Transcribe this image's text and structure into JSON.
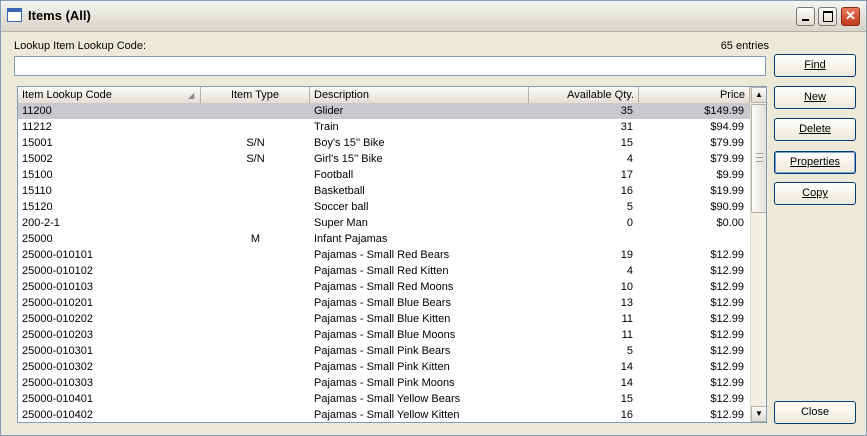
{
  "window": {
    "title": "Items (All)"
  },
  "lookup": {
    "label": "Lookup Item Lookup Code:",
    "value": "",
    "entries": "65 entries"
  },
  "columns": [
    "Item Lookup Code",
    "Item Type",
    "Description",
    "Available Qty.",
    "Price"
  ],
  "rows": [
    {
      "code": "11200",
      "type": "",
      "desc": "Glider",
      "qty": "35",
      "price": "$149.99",
      "selected": true
    },
    {
      "code": "11212",
      "type": "",
      "desc": "Train",
      "qty": "31",
      "price": "$94.99"
    },
    {
      "code": "15001",
      "type": "S/N",
      "desc": "Boy's 15'' Bike",
      "qty": "15",
      "price": "$79.99"
    },
    {
      "code": "15002",
      "type": "S/N",
      "desc": "Girl's 15'' Bike",
      "qty": "4",
      "price": "$79.99"
    },
    {
      "code": "15100",
      "type": "",
      "desc": "Football",
      "qty": "17",
      "price": "$9.99"
    },
    {
      "code": "15110",
      "type": "",
      "desc": "Basketball",
      "qty": "16",
      "price": "$19.99"
    },
    {
      "code": "15120",
      "type": "",
      "desc": "Soccer ball",
      "qty": "5",
      "price": "$90.99"
    },
    {
      "code": "200-2-1",
      "type": "",
      "desc": "Super Man",
      "qty": "0",
      "price": "$0.00"
    },
    {
      "code": "25000",
      "type": "M",
      "desc": "Infant Pajamas",
      "qty": "",
      "price": ""
    },
    {
      "code": "25000-010101",
      "type": "",
      "desc": "Pajamas - Small Red Bears",
      "qty": "19",
      "price": "$12.99"
    },
    {
      "code": "25000-010102",
      "type": "",
      "desc": "Pajamas - Small Red Kitten",
      "qty": "4",
      "price": "$12.99"
    },
    {
      "code": "25000-010103",
      "type": "",
      "desc": "Pajamas - Small Red Moons",
      "qty": "10",
      "price": "$12.99"
    },
    {
      "code": "25000-010201",
      "type": "",
      "desc": "Pajamas - Small Blue Bears",
      "qty": "13",
      "price": "$12.99"
    },
    {
      "code": "25000-010202",
      "type": "",
      "desc": "Pajamas - Small Blue Kitten",
      "qty": "11",
      "price": "$12.99"
    },
    {
      "code": "25000-010203",
      "type": "",
      "desc": "Pajamas - Small Blue Moons",
      "qty": "11",
      "price": "$12.99"
    },
    {
      "code": "25000-010301",
      "type": "",
      "desc": "Pajamas - Small Pink Bears",
      "qty": "5",
      "price": "$12.99"
    },
    {
      "code": "25000-010302",
      "type": "",
      "desc": "Pajamas - Small Pink Kitten",
      "qty": "14",
      "price": "$12.99"
    },
    {
      "code": "25000-010303",
      "type": "",
      "desc": "Pajamas - Small Pink Moons",
      "qty": "14",
      "price": "$12.99"
    },
    {
      "code": "25000-010401",
      "type": "",
      "desc": "Pajamas - Small Yellow Bears",
      "qty": "15",
      "price": "$12.99"
    },
    {
      "code": "25000-010402",
      "type": "",
      "desc": "Pajamas - Small Yellow Kitten",
      "qty": "16",
      "price": "$12.99"
    }
  ],
  "buttons": {
    "find": "Find",
    "new": "New",
    "delete": "Delete",
    "properties": "Properties",
    "copy": "Copy",
    "close": "Close"
  },
  "icons": {
    "window": "window-icon",
    "minimize": "minimize-icon",
    "maximize": "maximize-icon",
    "close": "close-icon",
    "sort": "sort-ascending-icon",
    "scroll_up": "arrow-up-icon",
    "scroll_down": "arrow-down-icon"
  },
  "colors": {
    "selected_row": "#c9c8cd",
    "close_button": "#c23a1d",
    "border": "#7f9db9"
  }
}
